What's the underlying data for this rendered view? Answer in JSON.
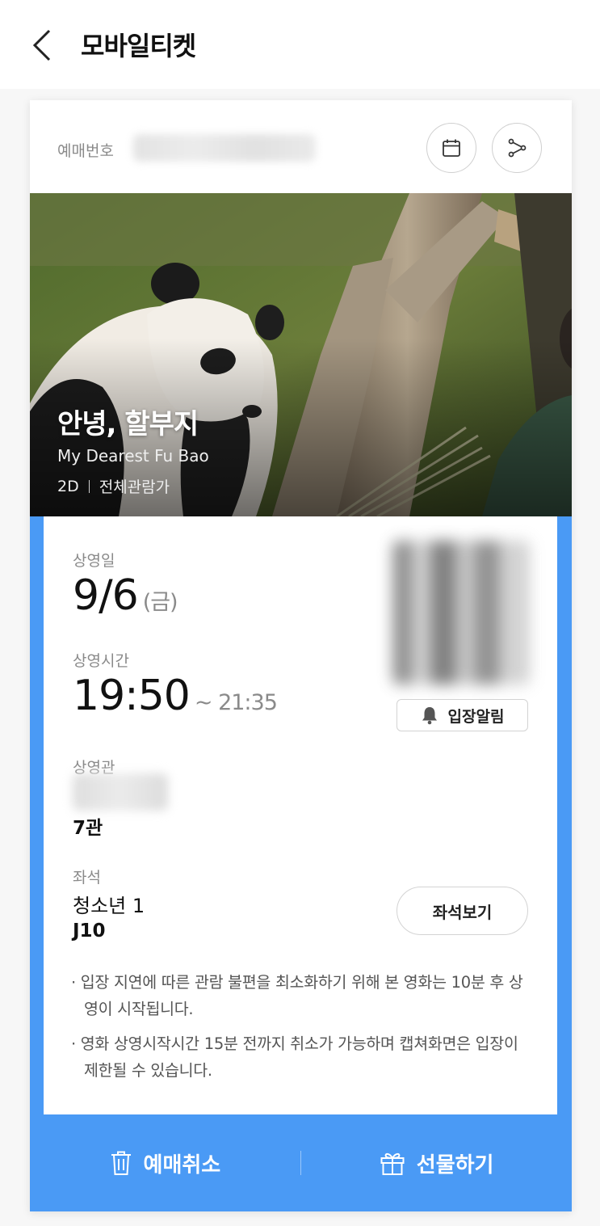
{
  "header": {
    "title": "모바일티켓"
  },
  "booking": {
    "label": "예매번호"
  },
  "movie": {
    "title": "안녕, 할부지",
    "subtitle": "My Dearest Fu Bao",
    "format": "2D",
    "rating": "전체관람가"
  },
  "ticket": {
    "date_label": "상영일",
    "date_value": "9/6",
    "date_weekday": "(금)",
    "time_label": "상영시간",
    "time_start": "19:50",
    "time_end": "~ 21:35",
    "enter_alarm_label": "입장알림",
    "theater_label": "상영관",
    "theater_value": "7관",
    "seat_label": "좌석",
    "seat_type": "청소년 1",
    "seat_value": "J10",
    "seat_view_label": "좌석보기",
    "notes": [
      "· 입장 지연에 따른 관람 불편을 최소화하기 위해 본 영화는 10분 후 상영이 시작됩니다.",
      "· 영화 상영시작시간 15분 전까지 취소가 가능하며 캡쳐화면은 입장이 제한될 수 있습니다."
    ]
  },
  "actions": {
    "cancel_label": "예매취소",
    "gift_label": "선물하기"
  },
  "icons": {
    "back": "chevron-left-icon",
    "calendar": "calendar-icon",
    "share": "share-icon",
    "bell": "bell-icon",
    "trash": "trash-icon",
    "gift": "gift-icon"
  },
  "colors": {
    "accent": "#4a9af5",
    "text": "#111111",
    "muted": "#8a8a8a"
  }
}
